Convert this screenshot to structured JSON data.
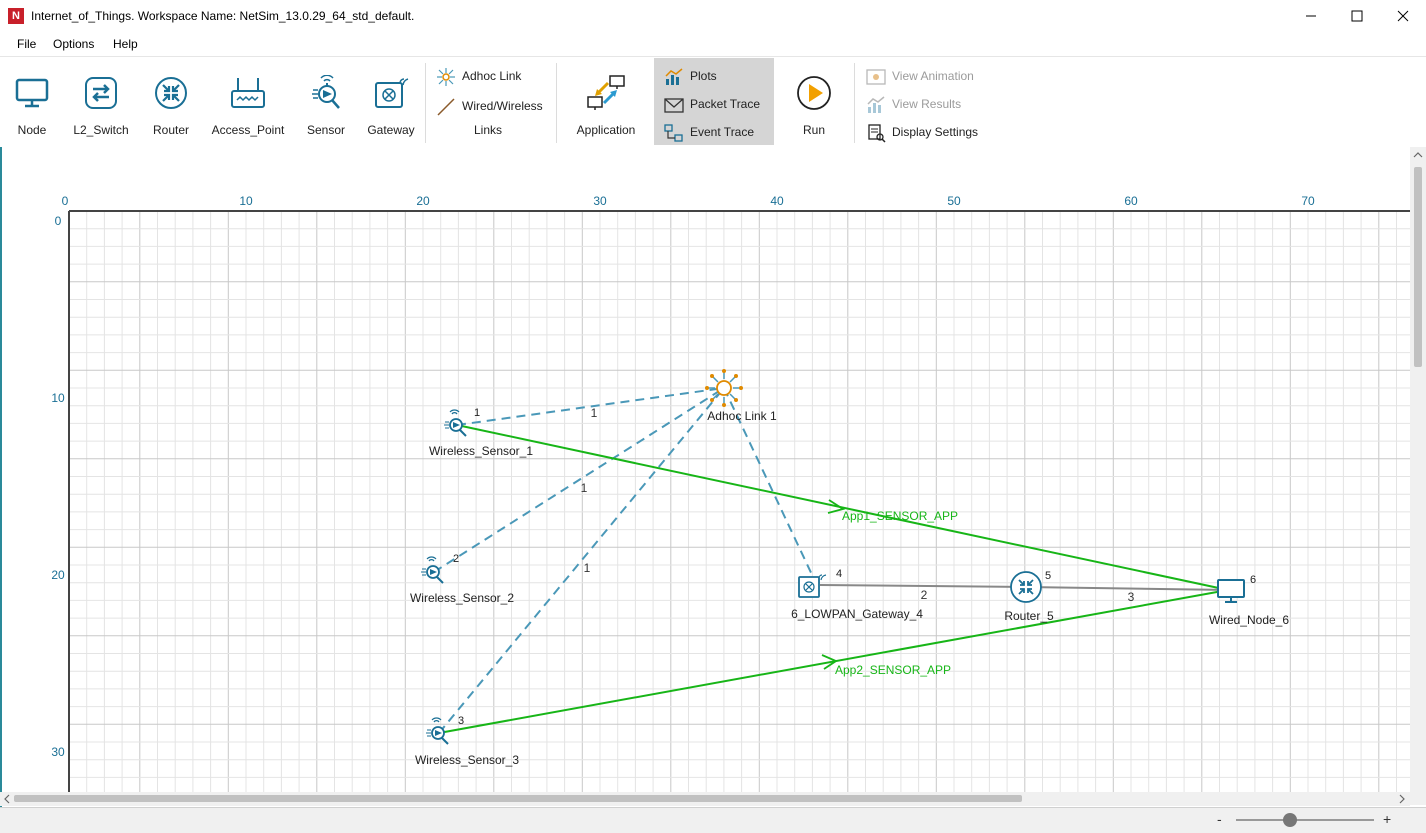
{
  "window": {
    "logo_letter": "N",
    "title": "Internet_of_Things. Workspace Name: NetSim_13.0.29_64_std_default."
  },
  "menu": [
    "File",
    "Options",
    "Help"
  ],
  "ribbon": {
    "devices": [
      "Node",
      "L2_Switch",
      "Router",
      "Access_Point",
      "Sensor",
      "Gateway"
    ],
    "links": {
      "adhoc": "Adhoc Link",
      "wired": "Wired/Wireless",
      "group": "Links"
    },
    "application": "Application",
    "analysis": {
      "plots": "Plots",
      "packet_trace": "Packet Trace",
      "event_trace": "Event Trace"
    },
    "run": "Run",
    "view": {
      "animation": "View Animation",
      "results": "View Results",
      "display": "Display Settings"
    }
  },
  "grid": {
    "x_ticks": [
      "0",
      "10",
      "20",
      "30",
      "40",
      "50",
      "60",
      "70"
    ],
    "y_ticks": [
      "0",
      "10",
      "20",
      "30"
    ]
  },
  "nodes": {
    "ws1": {
      "name": "Wireless_Sensor_1",
      "id": "1"
    },
    "ws2": {
      "name": "Wireless_Sensor_2",
      "id": "2"
    },
    "ws3": {
      "name": "Wireless_Sensor_3",
      "id": "3"
    },
    "gw": {
      "name": "6_LOWPAN_Gateway_4",
      "id": "4"
    },
    "router": {
      "name": "Router_5",
      "id": "5"
    },
    "wired": {
      "name": "Wired_Node_6",
      "id": "6"
    },
    "adhoc": {
      "name": "Adhoc Link 1"
    }
  },
  "links": {
    "adhoc_ws1": "1",
    "adhoc_ws2": "1",
    "adhoc_ws3": "1",
    "gw_router": "2",
    "router_wired": "3"
  },
  "apps": {
    "app1": "App1_SENSOR_APP",
    "app2": "App2_SENSOR_APP"
  },
  "colors": {
    "accent": "#1a6f95",
    "app_flow": "#17b517",
    "adhoc_link": "#4a98b8",
    "wired_link": "#888888"
  },
  "zoom": {
    "minus": "-",
    "plus": "+"
  }
}
